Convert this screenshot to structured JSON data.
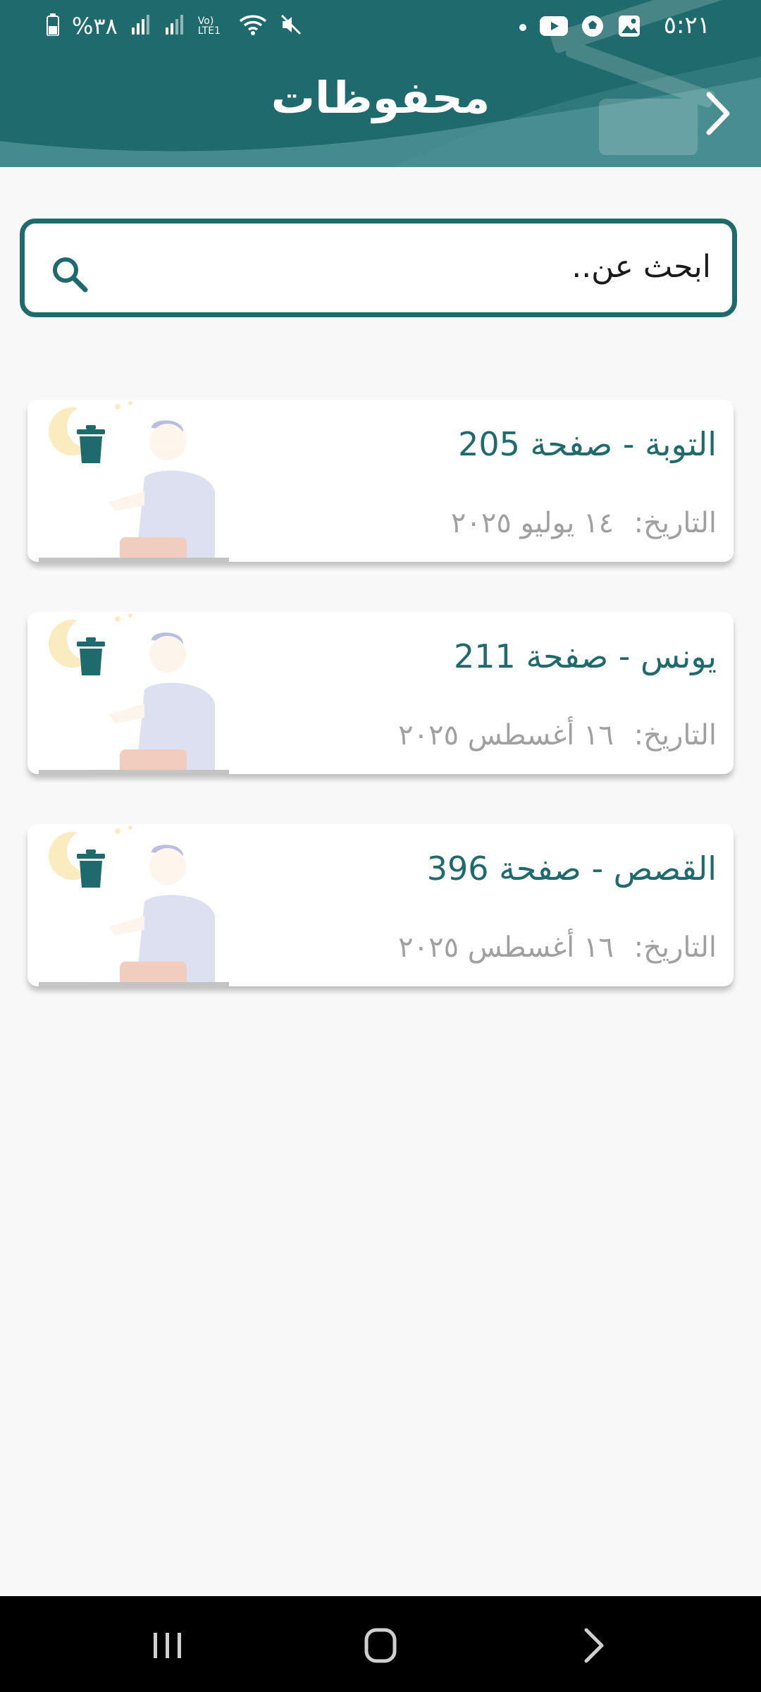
{
  "status_bar": {
    "time": "٥:٢١",
    "battery": "%٣٨",
    "network": "Vo) LTE1"
  },
  "header": {
    "title": "محفوظات",
    "background_color": "#1f6a6d"
  },
  "search": {
    "placeholder": "ابحث عن.."
  },
  "bookmarks": [
    {
      "title": "التوبة  - صفحة 205",
      "date_label": "التاريخ:",
      "date": "١٤ يوليو ٢٠٢٥"
    },
    {
      "title": "يونس  - صفحة 211",
      "date_label": "التاريخ:",
      "date": "١٦ أغسطس ٢٠٢٥"
    },
    {
      "title": "القصص  - صفحة 396",
      "date_label": "التاريخ:",
      "date": "١٦ أغسطس ٢٠٢٥"
    }
  ],
  "icons": {
    "back": "chevron-icon",
    "search": "search-icon",
    "delete": "trash-icon",
    "nav_recents": "recents-icon",
    "nav_home": "home-icon",
    "nav_back": "back-icon"
  },
  "colors": {
    "accent": "#1f6a6d",
    "date_text": "#a0a0a0"
  }
}
